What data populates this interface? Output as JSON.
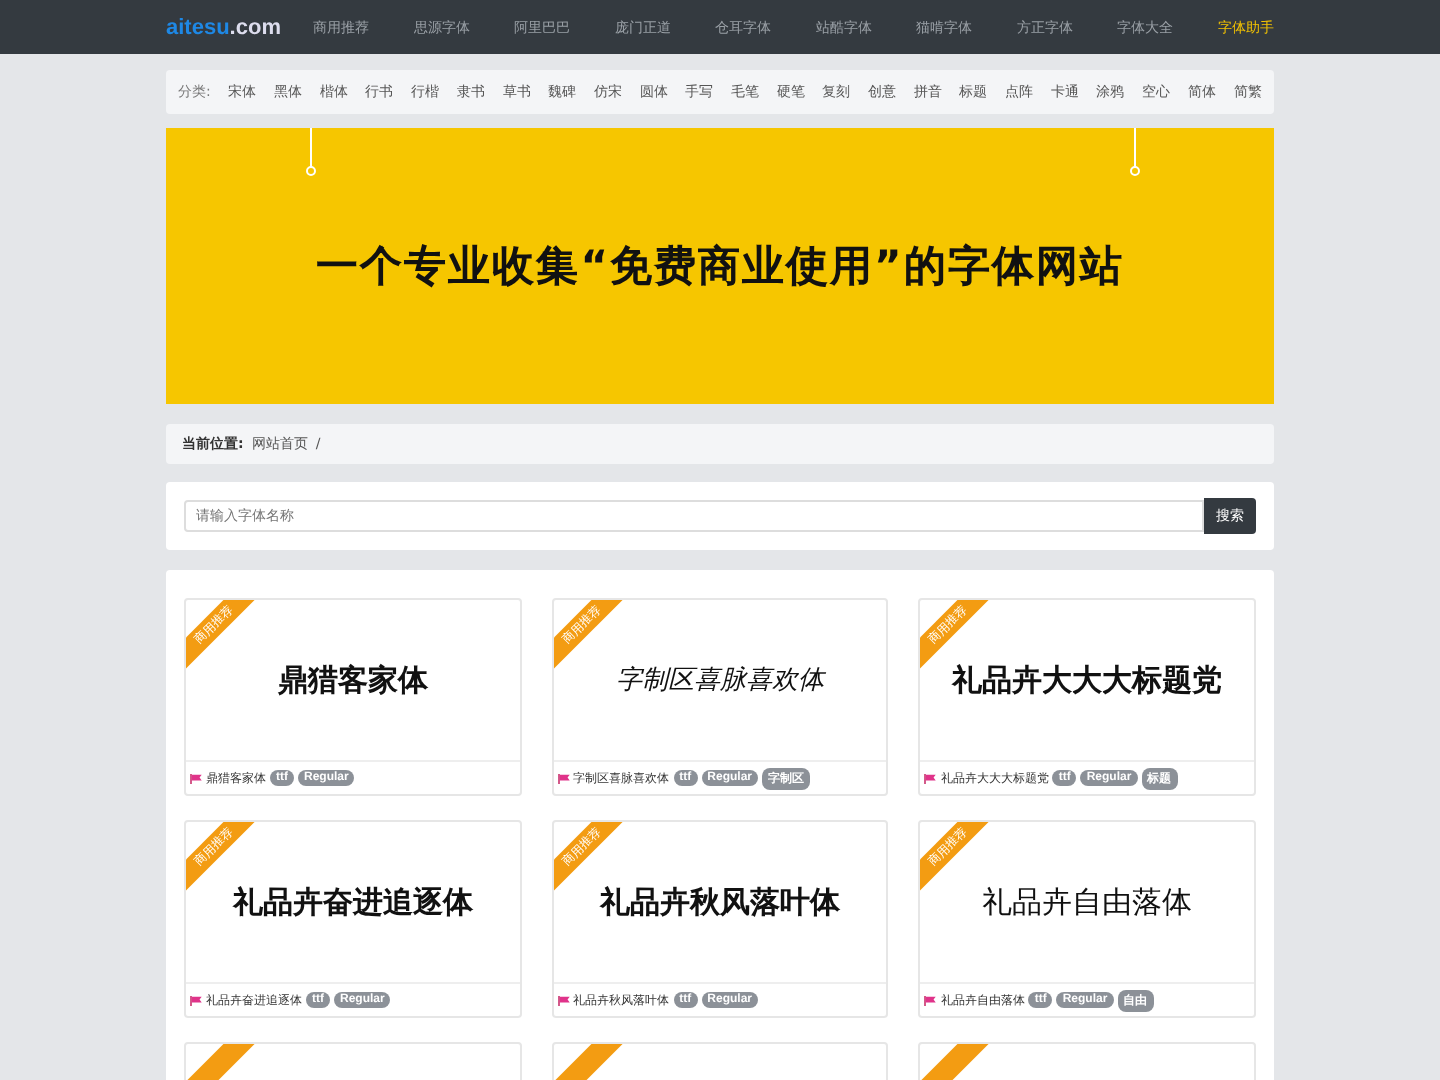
{
  "navbar": {
    "logo_main": "aitesu",
    "logo_suffix": ".com",
    "links": [
      {
        "label": "商用推荐",
        "selected": false
      },
      {
        "label": "思源字体",
        "selected": false
      },
      {
        "label": "阿里巴巴",
        "selected": false
      },
      {
        "label": "庞门正道",
        "selected": false
      },
      {
        "label": "仓耳字体",
        "selected": false
      },
      {
        "label": "站酷字体",
        "selected": false
      },
      {
        "label": "猫啃字体",
        "selected": false
      },
      {
        "label": "方正字体",
        "selected": false
      },
      {
        "label": "字体大全",
        "selected": false
      },
      {
        "label": "字体助手",
        "selected": true
      }
    ]
  },
  "categories": {
    "label": "分类:",
    "items": [
      "宋体",
      "黑体",
      "楷体",
      "行书",
      "行楷",
      "隶书",
      "草书",
      "魏碑",
      "仿宋",
      "圆体",
      "手写",
      "毛笔",
      "硬笔",
      "复刻",
      "创意",
      "拼音",
      "标题",
      "点阵",
      "卡通",
      "涂鸦",
      "空心",
      "简体",
      "简繁"
    ]
  },
  "banner": {
    "headline": "一个专业收集“免费商业使用”的字体网站"
  },
  "breadcrumb": {
    "label": "当前位置:",
    "items": [
      "网站首页",
      "/"
    ]
  },
  "search": {
    "placeholder": "请输入字体名称",
    "button": "搜索"
  },
  "fonts": [
    {
      "ribbon": "商用推荐",
      "sample": "鼎猎客家体",
      "kind": "serif",
      "name": "鼎猎客家体",
      "tags": [
        "ttf",
        "Regular"
      ]
    },
    {
      "ribbon": "商用推荐",
      "sample": "字制区喜脉喜欢体",
      "kind": "hand",
      "name": "字制区喜脉喜欢体",
      "tags": [
        "ttf",
        "Regular",
        "字制区"
      ]
    },
    {
      "ribbon": "商用推荐",
      "sample": "礼品卉大大大标题党",
      "kind": "bold",
      "name": "礼品卉大大大标题党",
      "tags": [
        "ttf",
        "Regular",
        "标题"
      ]
    },
    {
      "ribbon": "商用推荐",
      "sample": "礼品卉奋进追逐体",
      "kind": "bold",
      "name": "礼品卉奋进追逐体",
      "tags": [
        "ttf",
        "Regular"
      ]
    },
    {
      "ribbon": "商用推荐",
      "sample": "礼品卉秋风落叶体",
      "kind": "bold",
      "name": "礼品卉秋风落叶体",
      "tags": [
        "ttf",
        "Regular"
      ]
    },
    {
      "ribbon": "商用推荐",
      "sample": "礼品卉自由落体",
      "kind": "light",
      "name": "礼品卉自由落体",
      "tags": [
        "ttf",
        "Regular",
        "自由"
      ]
    },
    {
      "kind": "cut"
    },
    {
      "kind": "cut"
    },
    {
      "kind": "cut"
    }
  ]
}
